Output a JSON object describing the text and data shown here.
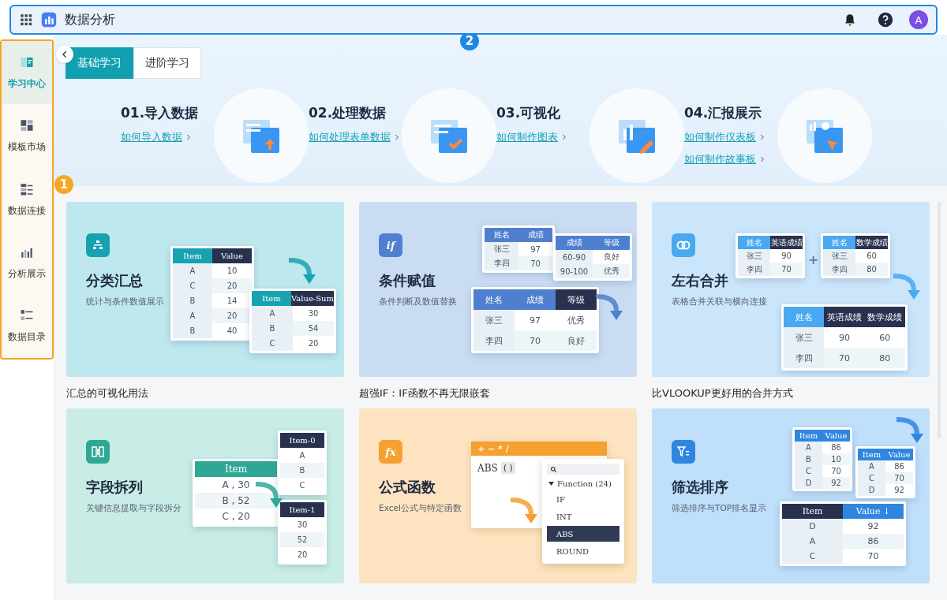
{
  "app_bar": {
    "title": "数据分析",
    "avatar": "A"
  },
  "annotations": [
    {
      "label": "1",
      "color": "#f5a623"
    },
    {
      "label": "2",
      "color": "#1e88e5"
    }
  ],
  "sidebar": {
    "items": [
      {
        "label": "学习中心",
        "selected": true
      },
      {
        "label": "模板市场",
        "selected": false
      },
      {
        "label": "数据连接",
        "selected": false
      },
      {
        "label": "分析展示",
        "selected": false
      },
      {
        "label": "数据目录",
        "selected": false
      }
    ]
  },
  "tabs": [
    {
      "label": "基础学习",
      "selected": true
    },
    {
      "label": "进阶学习",
      "selected": false
    }
  ],
  "steps": [
    {
      "title": "01.导入数据",
      "links": [
        "如何导入数据"
      ]
    },
    {
      "title": "02.处理数据",
      "links": [
        "如何处理表单数据"
      ]
    },
    {
      "title": "03.可视化",
      "links": [
        "如何制作图表"
      ]
    },
    {
      "title": "04.汇报展示",
      "links": [
        "如何制作仪表板",
        "如何制作故事板"
      ]
    }
  ],
  "cards": [
    {
      "title": "分类汇总",
      "subtitle": "统计与条件数值展示",
      "caption": "汇总的可视化用法",
      "color": "#bfe7ee",
      "parts": [
        {
          "kind": "table",
          "columns": [
            {
              "text": "Item",
              "dark": false
            },
            {
              "text": "Value",
              "dark": true
            }
          ],
          "rows": [
            [
              "A",
              "10"
            ],
            [
              "C",
              "20"
            ],
            [
              "B",
              "14"
            ],
            [
              "A",
              "20"
            ],
            [
              "B",
              "40"
            ]
          ]
        },
        {
          "kind": "table",
          "columns": [
            {
              "text": "Item",
              "dark": false
            },
            {
              "text": "Value-Sum",
              "dark": true
            }
          ],
          "rows": [
            [
              "A",
              "30"
            ],
            [
              "B",
              "54"
            ],
            [
              "C",
              "20"
            ]
          ]
        }
      ]
    },
    {
      "title": "条件赋值",
      "subtitle": "条件判断及数值替换",
      "caption": "超强IF：IF函数不再无限嵌套",
      "icon_text": "if",
      "color": "#cadcf3",
      "parts": [
        {
          "kind": "table",
          "columns": [
            {
              "text": "姓名",
              "dark": false
            },
            {
              "text": "成绩",
              "dark": false
            }
          ],
          "rows": [
            [
              "张三",
              "97"
            ],
            [
              "李四",
              "70"
            ]
          ]
        },
        {
          "kind": "table",
          "columns": [
            {
              "text": "成绩",
              "dark": false
            },
            {
              "text": "等级",
              "dark": false
            }
          ],
          "rows": [
            [
              "60-90",
              "良好"
            ],
            [
              "90-100",
              "优秀"
            ]
          ]
        },
        {
          "kind": "table",
          "columns": [
            {
              "text": "姓名",
              "dark": false
            },
            {
              "text": "成绩",
              "dark": false
            },
            {
              "text": "等级",
              "dark": true
            }
          ],
          "rows": [
            [
              "张三",
              "97",
              "优秀"
            ],
            [
              "李四",
              "70",
              "良好"
            ]
          ]
        }
      ]
    },
    {
      "title": "左右合并",
      "subtitle": "表格合并关联与横向连接",
      "caption": "比VLOOKUP更好用的合并方式",
      "color": "#cbe6fb",
      "parts": [
        {
          "kind": "table",
          "columns": [
            {
              "text": "姓名",
              "dark": false
            },
            {
              "text": "英语成绩",
              "dark": true
            }
          ],
          "rows": [
            [
              "张三",
              "90"
            ],
            [
              "李四",
              "70"
            ]
          ]
        },
        {
          "kind": "plus",
          "text": "+"
        },
        {
          "kind": "table",
          "columns": [
            {
              "text": "姓名",
              "dark": false
            },
            {
              "text": "数学成绩",
              "dark": true
            }
          ],
          "rows": [
            [
              "张三",
              "60"
            ],
            [
              "李四",
              "80"
            ]
          ]
        },
        {
          "kind": "table",
          "columns": [
            {
              "text": "姓名",
              "dark": false
            },
            {
              "text": "英语成绩",
              "dark": true
            },
            {
              "text": "数学成绩",
              "dark": true
            }
          ],
          "rows": [
            [
              "张三",
              "90",
              "60"
            ],
            [
              "李四",
              "70",
              "80"
            ]
          ]
        }
      ]
    },
    {
      "title": "字段拆列",
      "subtitle": "关键信息提取与字段拆分",
      "color": "#c9ede6",
      "parts": [
        {
          "kind": "table",
          "columns": [
            {
              "text": "Item",
              "dark": false
            }
          ],
          "rows": [
            [
              "A , 30"
            ],
            [
              "B , 52"
            ],
            [
              "C , 20"
            ]
          ]
        },
        {
          "kind": "table",
          "columns": [
            {
              "text": "Item-0",
              "dark": true
            }
          ],
          "rows": [
            [
              "A"
            ],
            [
              "B"
            ],
            [
              "C"
            ]
          ]
        },
        {
          "kind": "table",
          "columns": [
            {
              "text": "Item-1",
              "dark": true
            }
          ],
          "rows": [
            [
              "30"
            ],
            [
              "52"
            ],
            [
              "20"
            ]
          ]
        }
      ]
    },
    {
      "title": "公式函数",
      "subtitle": "Excel公式与特定函数",
      "icon_text": "fx",
      "color": "#fde3bf",
      "parts": [
        {
          "kind": "formula",
          "toolbar": "+ − * /",
          "expression": "ABS",
          "args": "( )"
        },
        {
          "kind": "function_list",
          "group": "Function (24)",
          "items": [
            {
              "text": "IF",
              "selected": false
            },
            {
              "text": "INT",
              "selected": false
            },
            {
              "text": "ABS",
              "selected": true
            },
            {
              "text": "ROUND",
              "selected": false
            }
          ]
        }
      ]
    },
    {
      "title": "筛选排序",
      "subtitle": "筛选排序与TOP排名显示",
      "color": "#bfdffb",
      "parts": [
        {
          "kind": "table",
          "columns": [
            {
              "text": "Item",
              "dark": false
            },
            {
              "text": "Value",
              "dark": false
            }
          ],
          "rows": [
            [
              "A",
              "86"
            ],
            [
              "B",
              "10"
            ],
            [
              "C",
              "70"
            ],
            [
              "D",
              "92"
            ]
          ]
        },
        {
          "kind": "table",
          "columns": [
            {
              "text": "Item",
              "dark": false
            },
            {
              "text": "Value",
              "dark": false
            }
          ],
          "rows": [
            [
              "A",
              "86"
            ],
            [
              "C",
              "70"
            ],
            [
              "D",
              "92"
            ]
          ]
        },
        {
          "kind": "table",
          "columns": [
            {
              "text": "Item",
              "dark": true
            },
            {
              "text": "Value ↓",
              "dark": false
            }
          ],
          "rows": [
            [
              "D",
              "92"
            ],
            [
              "A",
              "86"
            ],
            [
              "C",
              "70"
            ]
          ]
        }
      ]
    }
  ]
}
